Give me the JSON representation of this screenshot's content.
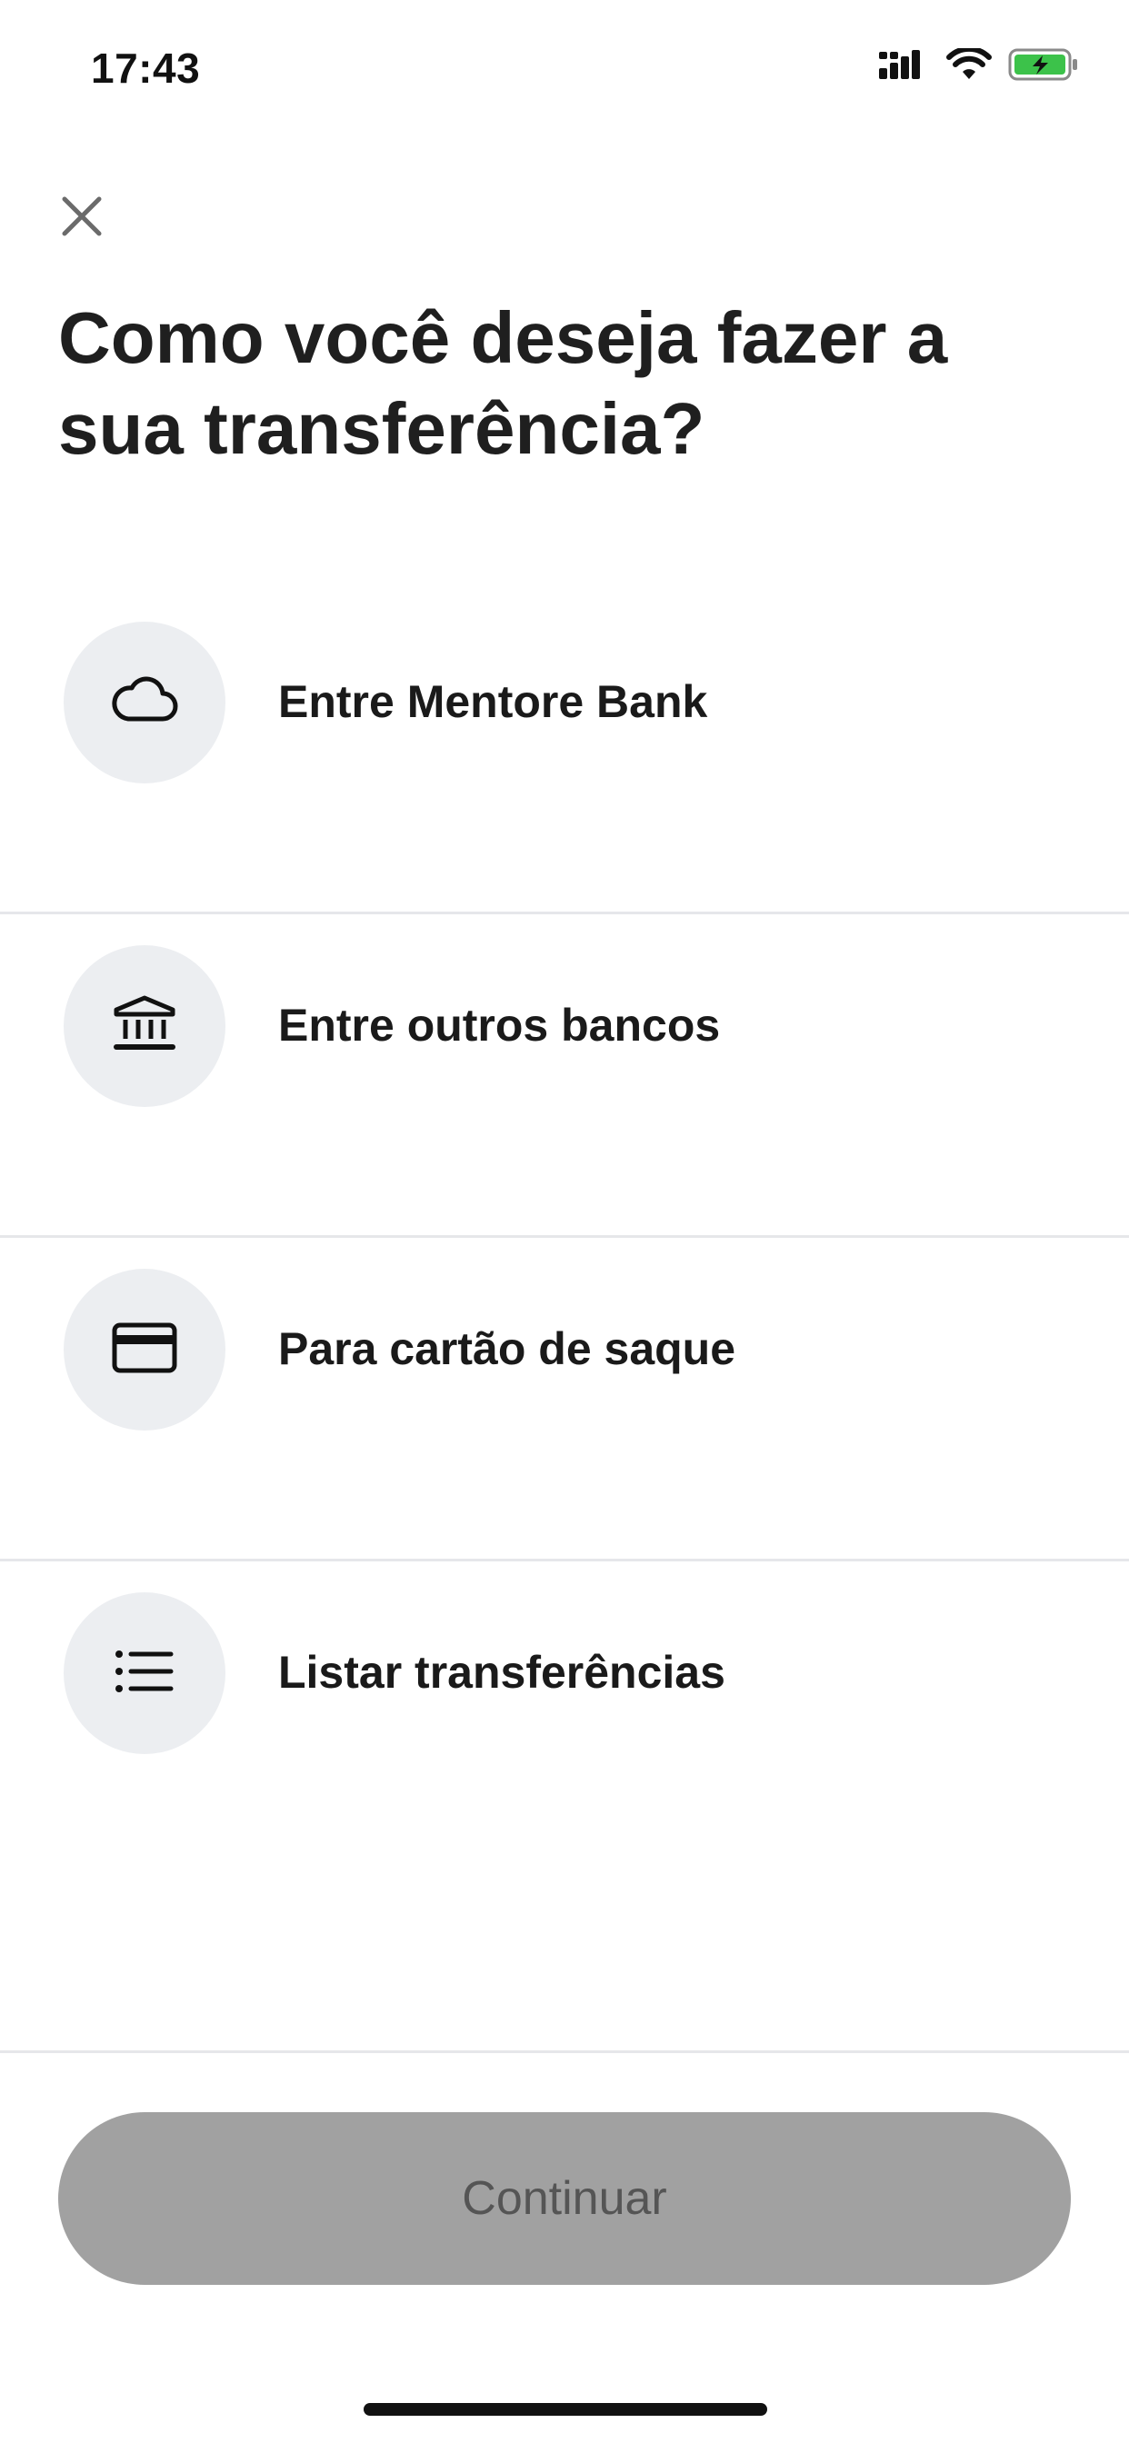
{
  "status_bar": {
    "time": "17:43",
    "icons": [
      "signal-icon",
      "wifi-icon",
      "battery-charging-icon"
    ],
    "battery_color": "#3cc24a"
  },
  "header": {
    "close_icon": "close-icon",
    "title": "Como você deseja fazer a sua transferência?"
  },
  "options": [
    {
      "label": "Entre Mentore Bank",
      "icon": "cloud-icon"
    },
    {
      "label": "Entre outros bancos",
      "icon": "bank-icon"
    },
    {
      "label": "Para cartão de saque",
      "icon": "card-icon"
    },
    {
      "label": "Listar transferências",
      "icon": "list-icon"
    }
  ],
  "footer": {
    "continue_label": "Continuar",
    "continue_bg": "#a1a1a1"
  }
}
